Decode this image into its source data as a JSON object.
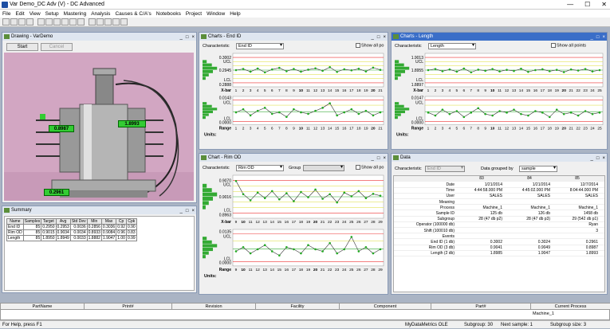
{
  "app": {
    "title": "Var Demo_DC Adv (V) - DC Advanced"
  },
  "menu": [
    "File",
    "Edit",
    "View",
    "Setup",
    "Mastering",
    "Analysis",
    "Causes & C/A's",
    "Notebooks",
    "Project",
    "Window",
    "Help"
  ],
  "toolbar": {
    "icons": [
      "new",
      "open",
      "save",
      "print",
      "chart",
      "bar",
      "histogram",
      "capability",
      "settings",
      "help",
      "cut",
      "copy",
      "paste",
      "email",
      "clear"
    ]
  },
  "drawing": {
    "title": "Drawing - VarDemo",
    "start": "Start",
    "cancel": "Cancel",
    "labels": [
      "0.8987",
      "1.8993",
      "0.2961"
    ]
  },
  "summary": {
    "title": "Summary",
    "headers": [
      "Name",
      "Samples",
      "Target",
      "Avg",
      "Std Dev",
      "Min",
      "Max",
      "Cp",
      "Cpk"
    ],
    "rows": [
      [
        "End ID",
        "85",
        "0.2950",
        "0.2953",
        "0.0036",
        "0.2856",
        "0.3036",
        "0.92",
        "0.90"
      ],
      [
        "Rim OD",
        "85",
        "0.9015",
        "0.9034",
        "0.0034",
        "0.8933",
        "0.9084",
        "0.96",
        "0.83"
      ],
      [
        "Length",
        "85",
        "1.8950",
        "1.8949",
        "0.0033",
        "1.8882",
        "1.9047",
        "1.00",
        "0.99"
      ]
    ]
  },
  "chart_end": {
    "title": "Charts - End ID",
    "char_label": "Characteristic",
    "char_value": "End ID",
    "show_all": "Show all po",
    "xbar": {
      "ucl": "0.3002",
      "ucl_l": "UCL",
      "mean": "0.2945",
      "lcl_l": "LCL",
      "lcl": "0.2888",
      "axis": "X-bar"
    },
    "range": {
      "ucl": "0.0143",
      "ucl_l": "UCL",
      "lcl_l": "LCL",
      "lcl": "0.0000",
      "axis": "Range"
    },
    "units": "Units:",
    "ticks": [
      "1",
      "2",
      "3",
      "4",
      "5",
      "6",
      "7",
      "8",
      "9",
      "10",
      "11",
      "12",
      "13",
      "14",
      "15",
      "16",
      "17",
      "18",
      "19",
      "20",
      "21"
    ]
  },
  "chart_len": {
    "title": "Charts - Length",
    "char_label": "Characteristic",
    "char_value": "Length",
    "show_all": "Show all points",
    "xbar": {
      "ucl": "1.9013",
      "ucl_l": "UCL",
      "mean": "1.8955",
      "lcl_l": "LCL",
      "lcl": "1.8897",
      "axis": "X-bar"
    },
    "range": {
      "ucl": "0.0147",
      "ucl_l": "UCL",
      "lcl_l": "LCL",
      "lcl": "0.0000",
      "axis": "Range"
    },
    "units": "Units:",
    "ticks": [
      "1",
      "2",
      "3",
      "4",
      "5",
      "6",
      "7",
      "8",
      "9",
      "10",
      "11",
      "12",
      "13",
      "14",
      "15",
      "16",
      "17",
      "18",
      "19",
      "20",
      "21",
      "22",
      "23",
      "24",
      "25"
    ]
  },
  "chart_rim": {
    "title": "Chart - Rim OD",
    "char_label": "Characteristic",
    "char_value": "Rim OD",
    "group_label": "Group",
    "show_all": "Show all po",
    "xbar": {
      "ucl": "0.9070",
      "ucl_l": "UCL",
      "mean": "0.9016",
      "lcl_l": "LCL",
      "lcl": "0.8963",
      "axis": "X-bar"
    },
    "range": {
      "ucl": "0.0135",
      "ucl_l": "UCL",
      "lcl_l": "LCL",
      "lcl": "0.0000",
      "axis": "Range"
    },
    "units": "Units:",
    "ticks": [
      "9",
      "10",
      "11",
      "12",
      "13",
      "14",
      "15",
      "16",
      "17",
      "18",
      "19",
      "20",
      "21",
      "22",
      "23",
      "24",
      "25",
      "26",
      "27",
      "28",
      "29"
    ]
  },
  "data": {
    "title": "Data",
    "char_label": "Characteristic",
    "char_value": "End ID",
    "grouped_label": "Data grouped by",
    "grouped_value": "sample",
    "row_labels": [
      "Date",
      "Time",
      "User",
      "Meaning",
      "Process",
      "Sample ID",
      "Subgroup",
      "Operator (100000 db)",
      "Shift (100010 db)",
      "Events",
      "End ID (1 db)",
      "Rim OD (3 db)",
      "Length (2 db)"
    ],
    "columns": [
      {
        "head": "83",
        "vals": [
          "1/21/2014",
          "4:44:58.000 PM",
          "SALES",
          "",
          "Machine_1",
          "125 db",
          "28 (47 db p2)",
          "",
          "",
          "",
          "0.3002",
          "0.9041",
          "1.8985"
        ]
      },
      {
        "head": "84",
        "vals": [
          "1/21/2014",
          "4:45:02.000 PM",
          "SALES",
          "",
          "Machine_1",
          "126 db",
          "28 (47 db p3)",
          "",
          "",
          "",
          "0.3024",
          "0.9049",
          "1.9047"
        ]
      },
      {
        "head": "85",
        "vals": [
          "12/7/2014",
          "8:04:44.000 PM",
          "SALES",
          "",
          "Machine_1",
          "1458 db",
          "29 (542 db p1)",
          "Ryan",
          "3",
          "",
          "0.2961",
          "0.8987",
          "1.8993"
        ]
      }
    ]
  },
  "bottom": {
    "headers": [
      "PartName",
      "Print#",
      "Revision",
      "Facility",
      "Component",
      "Part#",
      "Current Process"
    ],
    "current_process": "Machine_1"
  },
  "status": {
    "help": "For Help, press F1",
    "db": "MyDataMetrics OLE",
    "subgroup": "Subgroup: 30",
    "next": "Next sample: 1",
    "size": "Subgroup size: 3"
  },
  "chart_data": [
    {
      "type": "line",
      "title": "Charts - End ID X-bar",
      "ylim": [
        0.2888,
        0.3002
      ],
      "x": [
        1,
        2,
        3,
        4,
        5,
        6,
        7,
        8,
        9,
        10,
        11,
        12,
        13,
        14,
        15,
        16,
        17,
        18,
        19,
        20,
        21
      ],
      "values": [
        0.2945,
        0.295,
        0.2938,
        0.2952,
        0.2935,
        0.2948,
        0.2955,
        0.294,
        0.295,
        0.2938,
        0.2947,
        0.2953,
        0.2942,
        0.2958,
        0.2937,
        0.2949,
        0.2944,
        0.2951,
        0.2939,
        0.2956,
        0.2946
      ]
    },
    {
      "type": "line",
      "title": "Charts - End ID Range",
      "ylim": [
        0,
        0.0143
      ],
      "x": [
        1,
        2,
        3,
        4,
        5,
        6,
        7,
        8,
        9,
        10,
        11,
        12,
        13,
        14,
        15,
        16,
        17,
        18,
        19,
        20,
        21
      ],
      "values": [
        0.006,
        0.008,
        0.004,
        0.007,
        0.009,
        0.005,
        0.006,
        0.003,
        0.008,
        0.006,
        0.005,
        0.007,
        0.009,
        0.012,
        0.004,
        0.006,
        0.008,
        0.005,
        0.007,
        0.004,
        0.006
      ]
    },
    {
      "type": "line",
      "title": "Charts - Length X-bar",
      "ylim": [
        1.8897,
        1.9013
      ],
      "x": [
        1,
        2,
        3,
        4,
        5,
        6,
        7,
        8,
        9,
        10,
        11,
        12,
        13,
        14,
        15,
        16,
        17,
        18,
        19,
        20,
        21,
        22,
        23,
        24,
        25
      ],
      "values": [
        1.8955,
        1.896,
        1.895,
        1.8958,
        1.8948,
        1.8962,
        1.8945,
        1.8957,
        1.8952,
        1.896,
        1.8949,
        1.8956,
        1.8951,
        1.8961,
        1.8947,
        1.8955,
        1.8959,
        1.895,
        1.8956,
        1.8946,
        1.8958,
        1.8953,
        1.896,
        1.8949,
        1.8955
      ]
    },
    {
      "type": "line",
      "title": "Charts - Length Range",
      "ylim": [
        0,
        0.0147
      ],
      "x": [
        1,
        2,
        3,
        4,
        5,
        6,
        7,
        8,
        9,
        10,
        11,
        12,
        13,
        14,
        15,
        16,
        17,
        18,
        19,
        20,
        21,
        22,
        23,
        24,
        25
      ],
      "values": [
        0.006,
        0.004,
        0.008,
        0.005,
        0.007,
        0.003,
        0.006,
        0.009,
        0.005,
        0.004,
        0.007,
        0.006,
        0.008,
        0.005,
        0.004,
        0.007,
        0.006,
        0.003,
        0.008,
        0.005,
        0.006,
        0.004,
        0.007,
        0.005,
        0.006
      ]
    },
    {
      "type": "line",
      "title": "Chart - Rim OD X-bar",
      "ylim": [
        0.8963,
        0.907
      ],
      "x": [
        9,
        10,
        11,
        12,
        13,
        14,
        15,
        16,
        17,
        18,
        19,
        20,
        21,
        22,
        23,
        24,
        25,
        26,
        27,
        28,
        29
      ],
      "values": [
        0.9068,
        0.9025,
        0.9005,
        0.903,
        0.9012,
        0.9035,
        0.9008,
        0.9028,
        0.9002,
        0.9032,
        0.9015,
        0.904,
        0.901,
        0.9025,
        0.8998,
        0.903,
        0.9018,
        0.9035,
        0.9012,
        0.9026,
        0.902
      ]
    },
    {
      "type": "line",
      "title": "Chart - Rim OD Range",
      "ylim": [
        0,
        0.0135
      ],
      "x": [
        9,
        10,
        11,
        12,
        13,
        14,
        15,
        16,
        17,
        18,
        19,
        20,
        21,
        22,
        23,
        24,
        25,
        26,
        27,
        28,
        29
      ],
      "values": [
        0.005,
        0.007,
        0.004,
        0.006,
        0.008,
        0.005,
        0.003,
        0.007,
        0.006,
        0.004,
        0.008,
        0.006,
        0.005,
        0.009,
        0.004,
        0.006,
        0.012,
        0.005,
        0.007,
        0.004,
        0.006
      ]
    }
  ]
}
